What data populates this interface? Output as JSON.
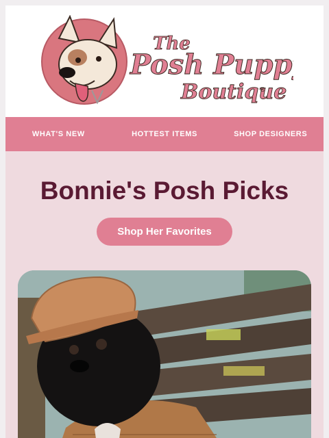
{
  "brand": {
    "logo_line1": "The",
    "logo_line2": "Posh Puppy",
    "logo_line3": "Boutique",
    "registered_mark": "®",
    "colors": {
      "pink": "#e07f93",
      "maroon": "#5a1a33",
      "blush": "#efdadf"
    }
  },
  "nav": {
    "items": [
      {
        "label": "WHAT'S NEW"
      },
      {
        "label": "HOTTEST ITEMS"
      },
      {
        "label": "SHOP DESIGNERS"
      }
    ]
  },
  "hero": {
    "title": "Bonnie's Posh Picks",
    "cta_label": "Shop Her Favorites"
  },
  "photo": {
    "subject": "black dog wearing a tan knit hat and sweater on a wooden bench"
  }
}
